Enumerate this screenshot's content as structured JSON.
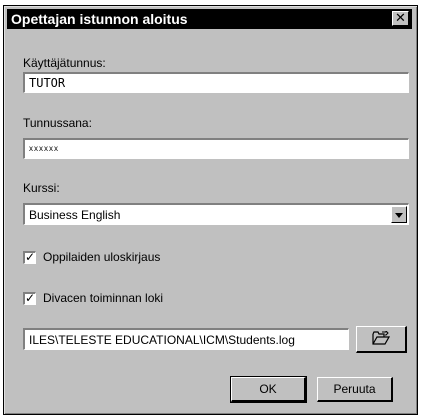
{
  "window": {
    "title": "Opettajan istunnon aloitus"
  },
  "username": {
    "label": "Käyttäjätunnus:",
    "value": "TUTOR"
  },
  "password": {
    "label": "Tunnussana:",
    "value": "xxxxxx"
  },
  "course": {
    "label": "Kurssi:",
    "selected": "Business English"
  },
  "checkboxes": {
    "student_logout": {
      "label": "Oppilaiden uloskirjaus",
      "checked": true,
      "mark": "✓"
    },
    "activity_log": {
      "label": "Divacen toiminnan loki",
      "checked": true,
      "mark": "✓"
    }
  },
  "log_path": {
    "value": "ILES\\TELESTE EDUCATIONAL\\ICM\\Students.log"
  },
  "buttons": {
    "ok": "OK",
    "cancel": "Peruuta"
  },
  "icons": {
    "close": "close-icon",
    "browse": "open-folder-icon"
  }
}
